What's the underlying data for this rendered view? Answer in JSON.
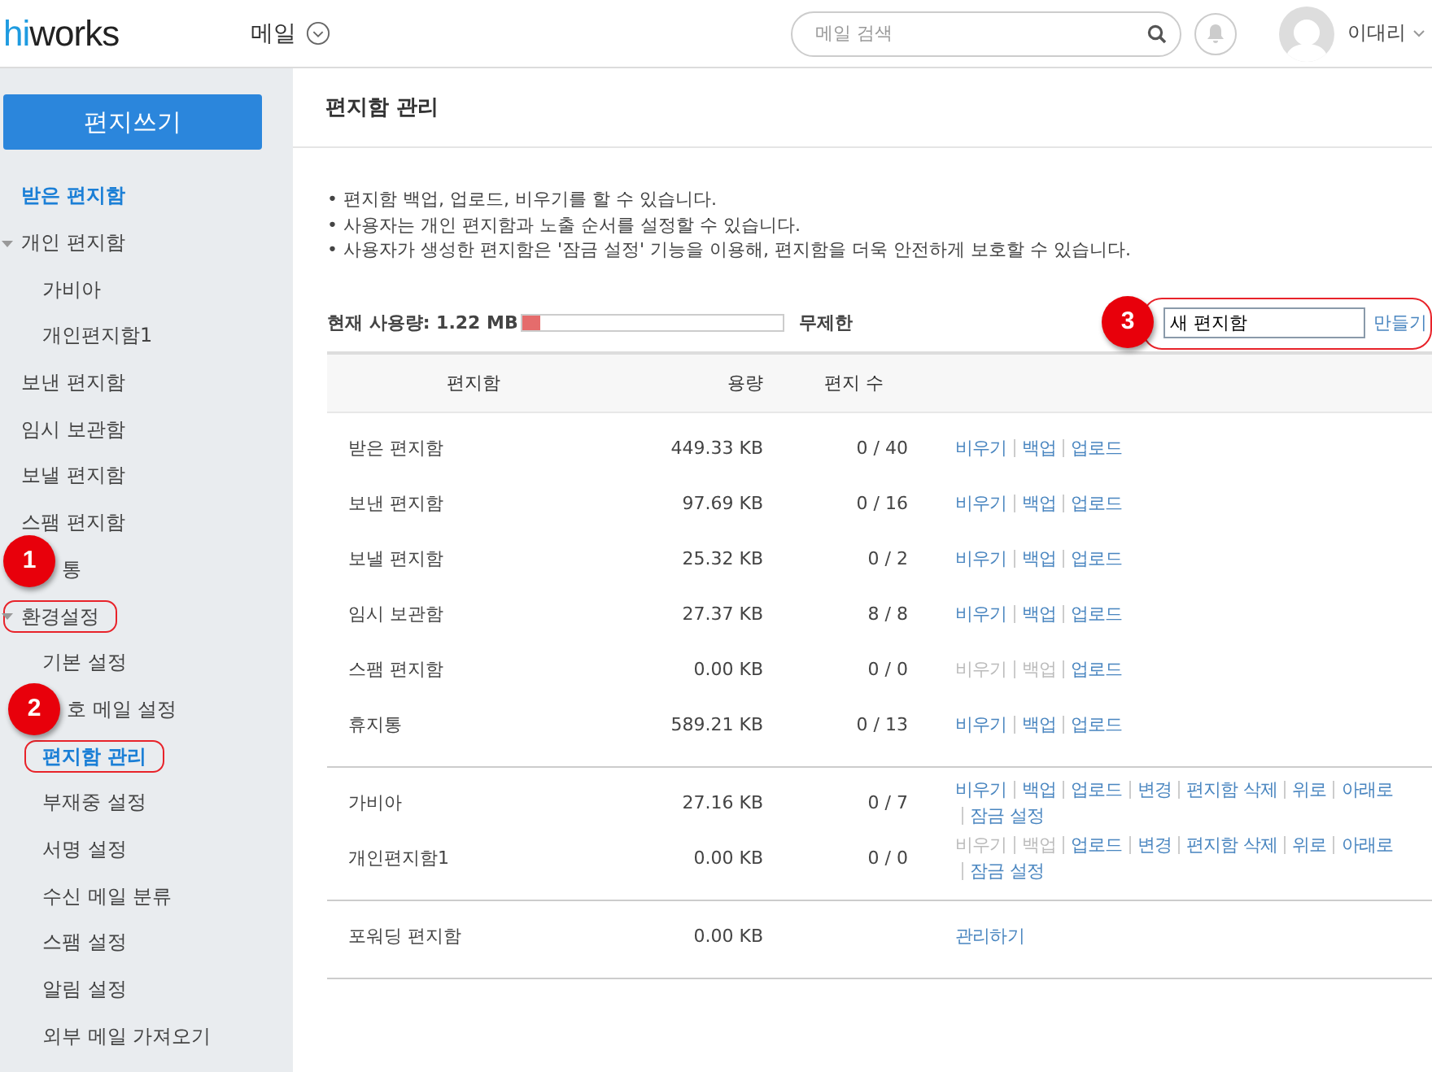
{
  "header": {
    "logo_hi": "hi",
    "logo_rest": "works",
    "app_menu": "메일",
    "search": {
      "placeholder": "메일 검색"
    },
    "user": "이대리"
  },
  "sidebar": {
    "compose": "편지쓰기",
    "items": [
      {
        "label": "받은 편지함",
        "selected": true,
        "highlighted": false
      },
      {
        "label": "개인 편지함",
        "selected": false,
        "highlighted": false,
        "expanded": true,
        "children": [
          {
            "label": "가비아",
            "selected": false,
            "highlighted": false
          },
          {
            "label": "개인편지함1",
            "selected": false,
            "highlighted": false
          }
        ]
      },
      {
        "label": "보낸 편지함",
        "selected": false,
        "highlighted": false
      },
      {
        "label": "임시 보관함",
        "selected": false,
        "highlighted": false
      },
      {
        "label": "보낼 편지함",
        "selected": false,
        "highlighted": false
      },
      {
        "label": "스팸 편지함",
        "selected": false,
        "highlighted": false
      },
      {
        "label": "통",
        "selected": false,
        "highlighted": false,
        "badge": "1"
      },
      {
        "label": "환경설정",
        "selected": false,
        "highlighted": true,
        "expanded": true,
        "children": [
          {
            "label": "기본 설정",
            "selected": false,
            "highlighted": false
          },
          {
            "label": "호 메일 설정",
            "selected": false,
            "highlighted": false,
            "badge": "2"
          },
          {
            "label": "편지함 관리",
            "selected": true,
            "highlighted": true
          },
          {
            "label": "부재중 설정",
            "selected": false,
            "highlighted": false
          },
          {
            "label": "서명 설정",
            "selected": false,
            "highlighted": false
          },
          {
            "label": "수신 메일 분류",
            "selected": false,
            "highlighted": false
          },
          {
            "label": "스팸 설정",
            "selected": false,
            "highlighted": false
          },
          {
            "label": "알림 설정",
            "selected": false,
            "highlighted": false
          },
          {
            "label": "외부 메일 가져오기",
            "selected": false,
            "highlighted": false
          }
        ]
      }
    ]
  },
  "main": {
    "title": "편지함 관리",
    "notes": [
      "• 편지함 백업, 업로드, 비우기를 할 수 있습니다.",
      "• 사용자는 개인 편지함과 노출 순서를 설정할 수 있습니다.",
      "• 사용자가 생성한 편지함은 '잠금 설정' 기능을 이용해, 편지함을 더욱 안전하게 보호할 수 있습니다."
    ],
    "usage": {
      "label": "현재 사용량: 1.22 MB",
      "level": 0.07,
      "limit": "무제한"
    },
    "new_folder": {
      "badge": "3",
      "value": "새 편지함",
      "button": "만들기",
      "highlighted": true
    },
    "table": {
      "columns": [
        "편지함",
        "용량",
        "편지 수"
      ],
      "groups": [
        [
          {
            "name": "받은 편지함",
            "size": "449.33 KB",
            "count": "0 / 40",
            "actions": [
              {
                "label": "비우기",
                "disabled": false
              },
              {
                "label": "백업",
                "disabled": false
              },
              {
                "label": "업로드",
                "disabled": false
              }
            ]
          },
          {
            "name": "보낸 편지함",
            "size": "97.69 KB",
            "count": "0 / 16",
            "actions": [
              {
                "label": "비우기",
                "disabled": false
              },
              {
                "label": "백업",
                "disabled": false
              },
              {
                "label": "업로드",
                "disabled": false
              }
            ]
          },
          {
            "name": "보낼 편지함",
            "size": "25.32 KB",
            "count": "0 / 2",
            "actions": [
              {
                "label": "비우기",
                "disabled": false
              },
              {
                "label": "백업",
                "disabled": false
              },
              {
                "label": "업로드",
                "disabled": false
              }
            ]
          },
          {
            "name": "임시 보관함",
            "size": "27.37 KB",
            "count": "8 / 8",
            "actions": [
              {
                "label": "비우기",
                "disabled": false
              },
              {
                "label": "백업",
                "disabled": false
              },
              {
                "label": "업로드",
                "disabled": false
              }
            ]
          },
          {
            "name": "스팸 편지함",
            "size": "0.00 KB",
            "count": "0 / 0",
            "actions": [
              {
                "label": "비우기",
                "disabled": true
              },
              {
                "label": "백업",
                "disabled": true
              },
              {
                "label": "업로드",
                "disabled": false
              }
            ]
          },
          {
            "name": "휴지통",
            "size": "589.21 KB",
            "count": "0 / 13",
            "actions": [
              {
                "label": "비우기",
                "disabled": false
              },
              {
                "label": "백업",
                "disabled": false
              },
              {
                "label": "업로드",
                "disabled": false
              }
            ]
          }
        ],
        [
          {
            "name": "가비아",
            "size": "27.16 KB",
            "count": "0 / 7",
            "actions": [
              {
                "label": "비우기",
                "disabled": false
              },
              {
                "label": "백업",
                "disabled": false
              },
              {
                "label": "업로드",
                "disabled": false
              },
              {
                "label": "변경",
                "disabled": false
              },
              {
                "label": "편지함 삭제",
                "disabled": false
              },
              {
                "label": "위로",
                "disabled": false
              },
              {
                "label": "아래로",
                "disabled": false
              },
              {
                "label": "잠금 설정",
                "disabled": false
              }
            ]
          },
          {
            "name": "개인편지함1",
            "size": "0.00 KB",
            "count": "0 / 0",
            "actions": [
              {
                "label": "비우기",
                "disabled": true
              },
              {
                "label": "백업",
                "disabled": true
              },
              {
                "label": "업로드",
                "disabled": false
              },
              {
                "label": "변경",
                "disabled": false
              },
              {
                "label": "편지함 삭제",
                "disabled": false
              },
              {
                "label": "위로",
                "disabled": false
              },
              {
                "label": "아래로",
                "disabled": false
              },
              {
                "label": "잠금 설정",
                "disabled": false
              }
            ]
          }
        ],
        [
          {
            "name": "포워딩 편지함",
            "size": "0.00 KB",
            "actions": [
              {
                "label": "관리하기",
                "disabled": false
              }
            ]
          }
        ]
      ]
    }
  }
}
